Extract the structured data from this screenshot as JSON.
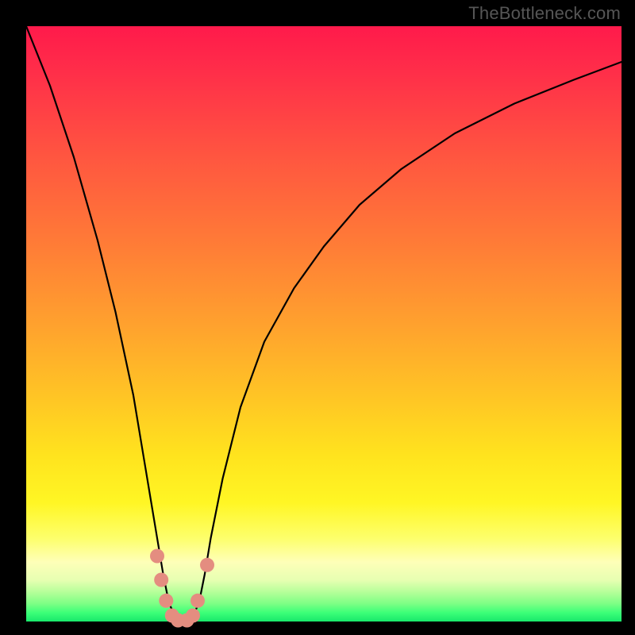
{
  "watermark": "TheBottleneck.com",
  "colors": {
    "page_bg": "#000000",
    "gradient_top": "#ff1a4b",
    "gradient_mid": "#ffc425",
    "gradient_bottom": "#18e86b",
    "curve": "#000000",
    "marker": "#e48d80"
  },
  "chart_data": {
    "type": "line",
    "title": "",
    "xlabel": "",
    "ylabel": "",
    "xlim": [
      0,
      100
    ],
    "ylim": [
      0,
      100
    ],
    "series": [
      {
        "name": "bottleneck-curve",
        "x": [
          0,
          4,
          8,
          12,
          15,
          18,
          20,
          22,
          23,
          24,
          25,
          26,
          27,
          28,
          29,
          30,
          31,
          33,
          36,
          40,
          45,
          50,
          56,
          63,
          72,
          82,
          92,
          100
        ],
        "values": [
          100,
          90,
          78,
          64,
          52,
          38,
          26,
          14,
          8,
          3,
          1,
          0,
          0,
          1,
          3,
          8,
          14,
          24,
          36,
          47,
          56,
          63,
          70,
          76,
          82,
          87,
          91,
          94
        ]
      }
    ],
    "markers": [
      {
        "x": 22.0,
        "y": 11.0
      },
      {
        "x": 22.7,
        "y": 7.0
      },
      {
        "x": 23.5,
        "y": 3.5
      },
      {
        "x": 24.5,
        "y": 1.0
      },
      {
        "x": 25.5,
        "y": 0.2
      },
      {
        "x": 27.0,
        "y": 0.2
      },
      {
        "x": 28.0,
        "y": 1.0
      },
      {
        "x": 28.8,
        "y": 3.5
      },
      {
        "x": 30.4,
        "y": 9.5
      }
    ],
    "grid": false,
    "legend": false
  }
}
